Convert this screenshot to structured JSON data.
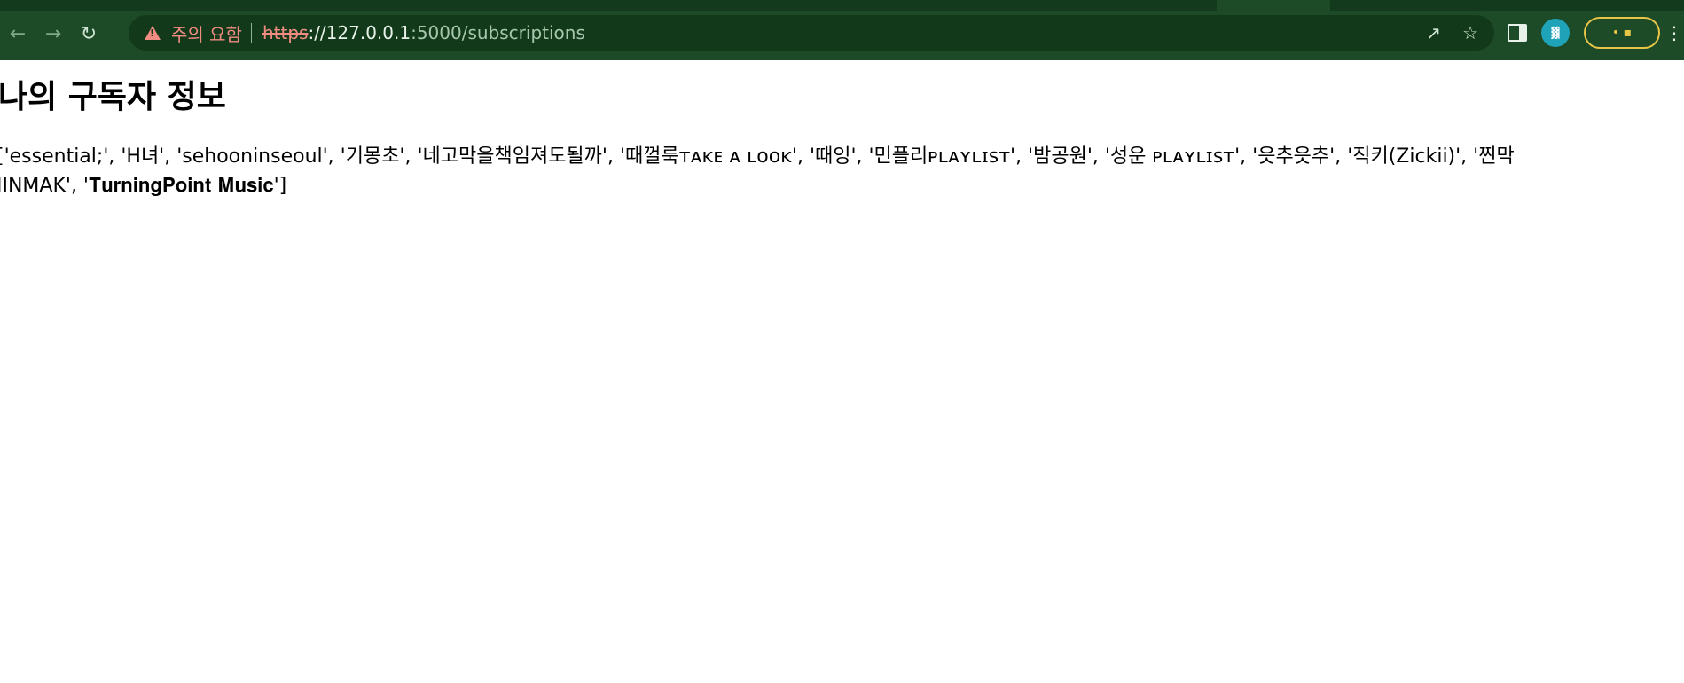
{
  "browser": {
    "security_label": "주의 요함",
    "url_scheme": "https",
    "url_host": "://127.0.0.1",
    "url_rest": ":5000/subscriptions",
    "ext_icon_text": "▓",
    "profile_chip_text": "• ▪"
  },
  "page": {
    "title": "나의 구독자 정보",
    "subscriptions_text": "['essential;', 'H녀', 'sehooninseoul', '기몽초', '네고막을책임져도될까', '때껄룩ᴛᴀᴋᴇ ᴀ ʟᴏᴏᴋ', '때잉', '민플리ᴘʟᴀʏʟɪsᴛ', '밤공원', '성운 ᴘʟᴀʏʟɪsᴛ', '읏추읏추', '직키(Zickii)', '찐막 JINMAK', '𝐓𝐮𝐫𝐧𝐢𝐧𝐠𝐏𝐨𝐢𝐧𝐭 𝐌𝐮𝐬𝐢𝐜']"
  },
  "colors": {
    "chrome_bg": "#1d4a27",
    "omnibox_bg": "#123a1a",
    "warning": "#f28b82",
    "profile_ring": "#e8c547"
  }
}
